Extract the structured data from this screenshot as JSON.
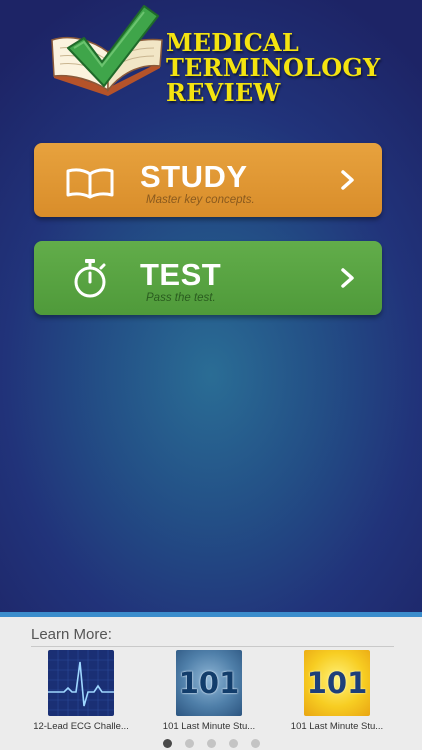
{
  "logo": {
    "line1": "MEDICAL",
    "line2": "TERMINOLOGY",
    "line3": "REVIEW"
  },
  "buttons": {
    "study": {
      "title": "STUDY",
      "subtitle": "Master key concepts."
    },
    "test": {
      "title": "TEST",
      "subtitle": "Pass the test."
    }
  },
  "learn_more": {
    "title": "Learn More:",
    "apps": [
      {
        "label": "12-Lead ECG Challe...",
        "icon": "ecg-icon"
      },
      {
        "label": "101 Last Minute Stu...",
        "icon_text": "101"
      },
      {
        "label": "101 Last Minute Stu...",
        "icon_text": "101"
      }
    ],
    "page_count": 5,
    "active_page": 1
  },
  "colors": {
    "study": "#e0962f",
    "test": "#56a240",
    "logo_text": "#f4e310",
    "panel_accent": "#3b8dcc"
  }
}
